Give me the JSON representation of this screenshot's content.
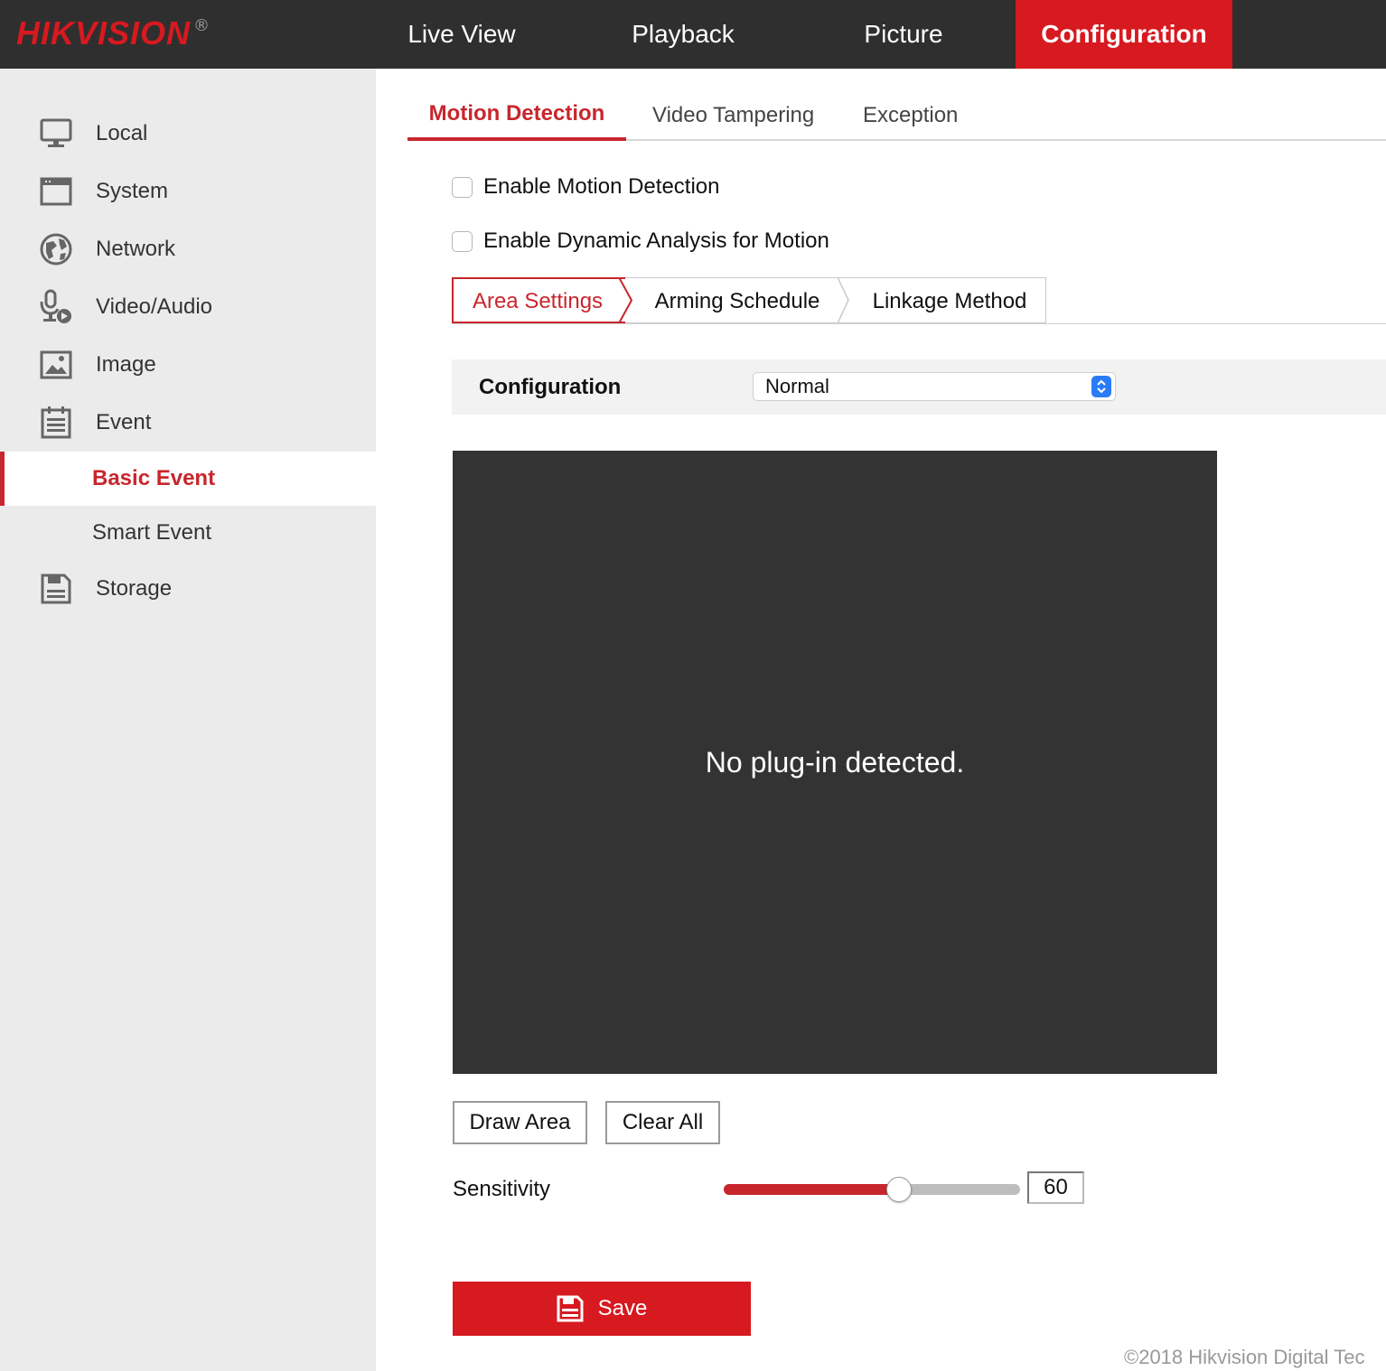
{
  "brand": {
    "logo_text": "HIKVISION",
    "registered_mark": "®",
    "accent_color": "#d71920"
  },
  "topnav": {
    "items": [
      {
        "label": "Live View",
        "active": false
      },
      {
        "label": "Playback",
        "active": false
      },
      {
        "label": "Picture",
        "active": false
      },
      {
        "label": "Configuration",
        "active": true
      }
    ]
  },
  "sidebar": {
    "items": [
      {
        "label": "Local",
        "icon": "monitor-icon"
      },
      {
        "label": "System",
        "icon": "window-icon"
      },
      {
        "label": "Network",
        "icon": "globe-icon"
      },
      {
        "label": "Video/Audio",
        "icon": "microphone-video-icon"
      },
      {
        "label": "Image",
        "icon": "image-icon"
      },
      {
        "label": "Event",
        "icon": "calendar-list-icon"
      },
      {
        "label": "Storage",
        "icon": "floppy-disk-icon"
      }
    ],
    "event_subitems": [
      {
        "label": "Basic Event",
        "active": true
      },
      {
        "label": "Smart Event",
        "active": false
      }
    ]
  },
  "tabs": [
    {
      "label": "Motion Detection",
      "active": true
    },
    {
      "label": "Video Tampering",
      "active": false
    },
    {
      "label": "Exception",
      "active": false
    }
  ],
  "options": {
    "enable_motion_detection": {
      "label": "Enable Motion Detection",
      "checked": false
    },
    "enable_dynamic_analysis": {
      "label": "Enable Dynamic Analysis for Motion",
      "checked": false
    }
  },
  "subtabs": [
    {
      "label": "Area Settings",
      "active": true
    },
    {
      "label": "Arming Schedule",
      "active": false
    },
    {
      "label": "Linkage Method",
      "active": false
    }
  ],
  "configuration": {
    "label": "Configuration",
    "selected": "Normal"
  },
  "video": {
    "message": "No plug-in detected."
  },
  "buttons": {
    "draw_area": "Draw Area",
    "clear_all": "Clear All",
    "save": "Save"
  },
  "sensitivity": {
    "label": "Sensitivity",
    "value": "60",
    "level_percent": 60
  },
  "footer": {
    "copyright": "©2018 Hikvision Digital Tec"
  }
}
